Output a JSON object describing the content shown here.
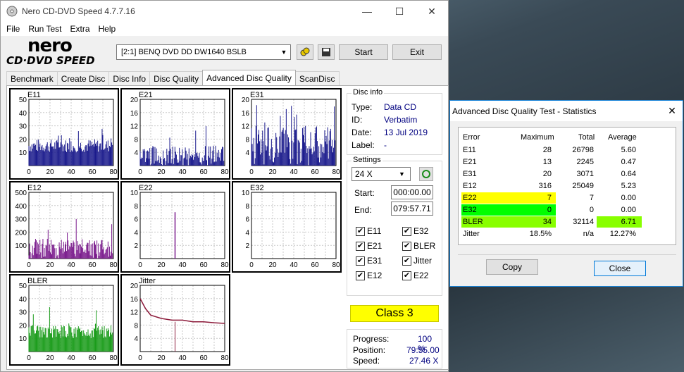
{
  "app": {
    "title": "Nero CD-DVD Speed 4.7.7.16",
    "minimize": "—",
    "maximize": "☐",
    "close": "✕"
  },
  "menu": [
    "File",
    "Run Test",
    "Extra",
    "Help"
  ],
  "logo": {
    "line1": "nero",
    "line2": "CD·DVD SPEED"
  },
  "toolbar": {
    "drive": "[2:1]   BENQ DVD DD DW1640 BSLB",
    "start": "Start",
    "exit": "Exit"
  },
  "tabs": [
    "Benchmark",
    "Create Disc",
    "Disc Info",
    "Disc Quality",
    "Advanced Disc Quality",
    "ScanDisc"
  ],
  "charts": [
    {
      "name": "E11",
      "ymax": 50,
      "yticks": [
        50,
        40,
        30,
        20,
        10
      ],
      "color": "#1a1a8c",
      "type": "bar"
    },
    {
      "name": "E21",
      "ymax": 20,
      "yticks": [
        20,
        16,
        12,
        8,
        4
      ],
      "color": "#1a1a8c",
      "type": "bar"
    },
    {
      "name": "E31",
      "ymax": 20,
      "yticks": [
        20,
        16,
        12,
        8,
        4
      ],
      "color": "#1a1a8c",
      "type": "bar"
    },
    {
      "name": "E12",
      "ymax": 500,
      "yticks": [
        500,
        400,
        300,
        200,
        100
      ],
      "color": "#7a1a8c",
      "type": "bar"
    },
    {
      "name": "E22",
      "ymax": 10,
      "yticks": [
        10,
        8,
        6,
        4,
        2
      ],
      "color": "#7a1a8c",
      "type": "bar"
    },
    {
      "name": "E32",
      "ymax": 10,
      "yticks": [
        10,
        8,
        6,
        4,
        2
      ],
      "color": "#7a1a8c",
      "type": "bar"
    },
    {
      "name": "BLER",
      "ymax": 50,
      "yticks": [
        50,
        40,
        30,
        20,
        10
      ],
      "color": "#1a9c1a",
      "type": "bar"
    },
    {
      "name": "Jitter",
      "ymax": 20,
      "yticks": [
        20,
        16,
        12,
        8,
        4
      ],
      "color": "#8c1a3a",
      "type": "line"
    }
  ],
  "xticks": [
    0,
    20,
    40,
    60,
    80
  ],
  "chart_data": [
    {
      "type": "bar",
      "title": "E11",
      "x_range": [
        0,
        80
      ],
      "ylim": [
        0,
        50
      ],
      "peak": 28,
      "typical": [
        10,
        20
      ]
    },
    {
      "type": "bar",
      "title": "E21",
      "x_range": [
        0,
        80
      ],
      "ylim": [
        0,
        20
      ],
      "peak": 13,
      "typical": [
        0,
        6
      ]
    },
    {
      "type": "bar",
      "title": "E31",
      "x_range": [
        0,
        80
      ],
      "ylim": [
        0,
        20
      ],
      "peak": 20,
      "typical": [
        0,
        12
      ]
    },
    {
      "type": "bar",
      "title": "E12",
      "x_range": [
        0,
        80
      ],
      "ylim": [
        0,
        500
      ],
      "peak": 316,
      "typical": [
        0,
        150
      ]
    },
    {
      "type": "bar",
      "title": "E22",
      "x_range": [
        0,
        80
      ],
      "ylim": [
        0,
        10
      ],
      "spikes": [
        {
          "x": 33,
          "y": 7
        }
      ]
    },
    {
      "type": "bar",
      "title": "E32",
      "x_range": [
        0,
        80
      ],
      "ylim": [
        0,
        10
      ],
      "values": []
    },
    {
      "type": "bar",
      "title": "BLER",
      "x_range": [
        0,
        80
      ],
      "ylim": [
        0,
        50
      ],
      "peak": 34,
      "typical": [
        10,
        20
      ]
    },
    {
      "type": "line",
      "title": "Jitter",
      "x_range": [
        0,
        80
      ],
      "ylim": [
        0,
        20
      ],
      "x": [
        0,
        5,
        10,
        20,
        30,
        40,
        50,
        60,
        70,
        80
      ],
      "values": [
        16,
        13,
        11,
        10,
        9.5,
        9.5,
        9,
        9,
        8.7,
        8.5
      ]
    }
  ],
  "discinfo": {
    "group": "Disc info",
    "type_label": "Type:",
    "type": "Data CD",
    "id_label": "ID:",
    "id": "Verbatim",
    "date_label": "Date:",
    "date": "13 Jul 2019",
    "label_label": "Label:",
    "label": "-"
  },
  "settings": {
    "group": "Settings",
    "speed": "24 X",
    "start_label": "Start:",
    "start": "000:00.00",
    "end_label": "End:",
    "end": "079:57.71"
  },
  "checks": [
    {
      "label": "E11",
      "checked": true
    },
    {
      "label": "E32",
      "checked": true
    },
    {
      "label": "E21",
      "checked": true
    },
    {
      "label": "BLER",
      "checked": true
    },
    {
      "label": "E31",
      "checked": true
    },
    {
      "label": "Jitter",
      "checked": true
    },
    {
      "label": "E12",
      "checked": true
    },
    {
      "label": "E22",
      "checked": true
    }
  ],
  "class": "Class 3",
  "progress": {
    "progress_label": "Progress:",
    "progress": "100 %",
    "position_label": "Position:",
    "position": "79:55.00",
    "speed_label": "Speed:",
    "speed": "27.46 X"
  },
  "stats": {
    "title": "Advanced Disc Quality Test - Statistics",
    "headers": [
      "Error",
      "Maximum",
      "Total",
      "Average"
    ],
    "rows": [
      {
        "error": "E11",
        "max": "28",
        "total": "26798",
        "avg": "5.60"
      },
      {
        "error": "E21",
        "max": "13",
        "total": "2245",
        "avg": "0.47"
      },
      {
        "error": "E31",
        "max": "20",
        "total": "3071",
        "avg": "0.64"
      },
      {
        "error": "E12",
        "max": "316",
        "total": "25049",
        "avg": "5.23"
      },
      {
        "error": "E22",
        "max": "7",
        "total": "7",
        "avg": "0.00"
      },
      {
        "error": "E32",
        "max": "0",
        "total": "0",
        "avg": "0.00"
      },
      {
        "error": "BLER",
        "max": "34",
        "total": "32114",
        "avg": "6.71"
      },
      {
        "error": "Jitter",
        "max": "18.5%",
        "total": "n/a",
        "avg": "12.27%"
      }
    ],
    "copy": "Copy",
    "close": "Close",
    "highlight": {
      "yellow": "#ffff00",
      "green": "#00ff00",
      "lime": "#88ff00"
    }
  }
}
